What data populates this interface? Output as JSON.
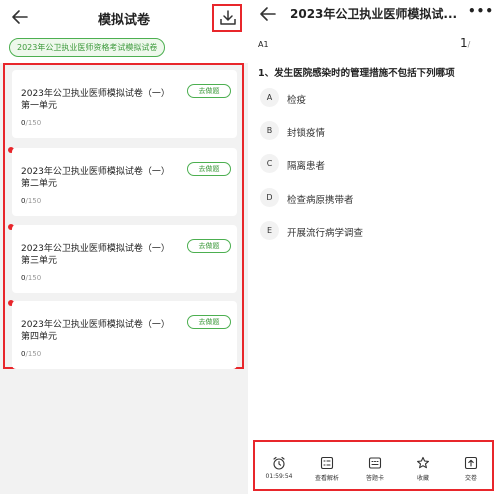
{
  "left": {
    "title": "模拟试卷",
    "category": "2023年公卫执业医师资格考试模拟试卷",
    "papers": [
      {
        "title": "2023年公卫执业医师模拟试卷（一）第一单元",
        "done": "0",
        "total": "/150",
        "button": "去做题",
        "new": false
      },
      {
        "title": "2023年公卫执业医师模拟试卷（一）第二单元",
        "done": "0",
        "total": "/150",
        "button": "去做题",
        "new": true
      },
      {
        "title": "2023年公卫执业医师模拟试卷（一）第三单元",
        "done": "0",
        "total": "/150",
        "button": "去做题",
        "new": true
      },
      {
        "title": "2023年公卫执业医师模拟试卷（一）第四单元",
        "done": "0",
        "total": "/150",
        "button": "去做题",
        "new": true
      }
    ]
  },
  "right": {
    "title": "2023年公卫执业医师模拟试...",
    "more": "•••",
    "question_type": "A1",
    "current": "1",
    "total": "/",
    "question": "1、发生医院感染时的管理措施不包括下列哪项",
    "options": [
      {
        "letter": "A",
        "text": "检疫"
      },
      {
        "letter": "B",
        "text": "封锁疫情"
      },
      {
        "letter": "C",
        "text": "隔离患者"
      },
      {
        "letter": "D",
        "text": "检查病原携带者"
      },
      {
        "letter": "E",
        "text": "开展流行病学调查"
      }
    ],
    "toolbar": {
      "timer": "01:59:54",
      "analysis": "查看解析",
      "answer_card": "答题卡",
      "favorite": "收藏",
      "submit": "交卷"
    }
  },
  "colors": {
    "accent_green": "#4caf50",
    "highlight_red": "#e8262b"
  }
}
